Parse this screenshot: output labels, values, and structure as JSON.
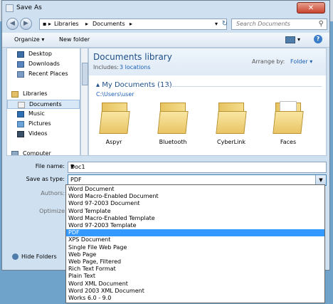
{
  "window": {
    "title": "Save As"
  },
  "nav": {
    "address_parts": [
      "Libraries",
      "Documents"
    ],
    "search_placeholder": "Search Documents"
  },
  "toolbar": {
    "organize_label": "Organize ▾",
    "new_folder_label": "New folder"
  },
  "sidebar": {
    "items": [
      {
        "label": "Desktop",
        "icon": "desktop-icon"
      },
      {
        "label": "Downloads",
        "icon": "downloads-icon"
      },
      {
        "label": "Recent Places",
        "icon": "recent-places-icon"
      },
      {
        "label": "Libraries",
        "icon": "libraries-icon"
      },
      {
        "label": "Documents",
        "icon": "documents-icon",
        "selected": true
      },
      {
        "label": "Music",
        "icon": "music-icon"
      },
      {
        "label": "Pictures",
        "icon": "pictures-icon"
      },
      {
        "label": "Videos",
        "icon": "videos-icon"
      },
      {
        "label": "Computer",
        "icon": "computer-icon"
      }
    ]
  },
  "library": {
    "title": "Documents library",
    "includes_label": "Includes:",
    "locations_link": "3 locations",
    "arrange_label": "Arrange by:",
    "arrange_value": "Folder ▾",
    "group_title": "My Documents (13)",
    "path": "C:\\Users\\user",
    "folders": [
      "Aspyr",
      "Bluetooth",
      "CyberLink",
      "Faces"
    ]
  },
  "form": {
    "file_name_label": "File name:",
    "file_name_value": "Doc1",
    "save_type_label": "Save as type:",
    "save_type_value": "PDF",
    "authors_label": "Authors:",
    "optimize_label": "Optimize",
    "hide_folders_label": "Hide Folders"
  },
  "type_options": [
    "Word Document",
    "Word Macro-Enabled Document",
    "Word 97-2003 Document",
    "Word Template",
    "Word Macro-Enabled Template",
    "Word 97-2003 Template",
    "PDF",
    "XPS Document",
    "Single File Web Page",
    "Web Page",
    "Web Page, Filtered",
    "Rich Text Format",
    "Plain Text",
    "Word XML Document",
    "Word 2003 XML Document",
    "Works 6.0 - 9.0"
  ],
  "selected_option_index": 6
}
